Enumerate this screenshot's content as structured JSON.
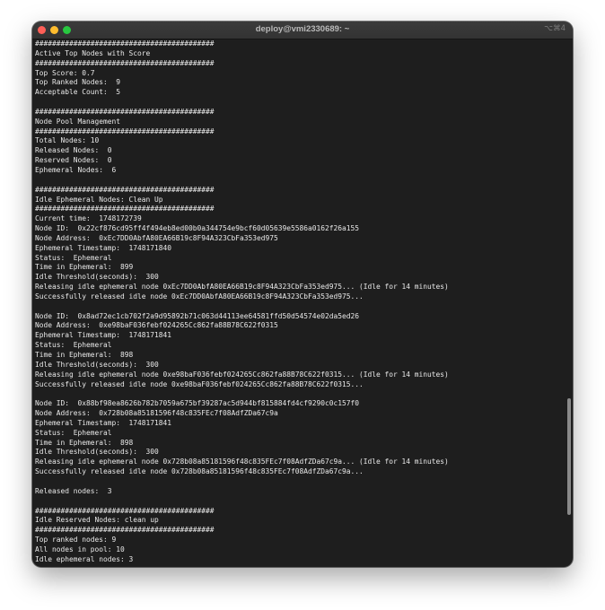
{
  "window": {
    "title": "deploy@vmi2330689: ~",
    "shortcut": "⌥⌘4"
  },
  "terminal": {
    "lines": [
      "##########################################",
      "Active Top Nodes with Score",
      "##########################################",
      "Top Score: 0.7",
      "Top Ranked Nodes:  9",
      "Acceptable Count:  5",
      "",
      "##########################################",
      "Node Pool Management",
      "##########################################",
      "Total Nodes: 10",
      "Released Nodes:  0",
      "Reserved Nodes:  0",
      "Ephemeral Nodes:  6",
      "",
      "##########################################",
      "Idle Ephemeral Nodes: Clean Up",
      "##########################################",
      "Current time:  1748172739",
      "Node ID:  0x22cf876cd95ff4f494eb8ed00b0a344754e9bcf60d05639e5586a0162f26a155",
      "Node Address:  0xEc7DD0AbfA80EA66B19c8F94A323CbFa353ed975",
      "Ephemeral Timestamp:  1748171840",
      "Status:  Ephemeral",
      "Time in Ephemeral:  899",
      "Idle Threshold(seconds):  300",
      "Releasing idle ephemeral node 0xEc7DD0AbfA80EA66B19c8F94A323CbFa353ed975... (Idle for 14 minutes)",
      "Successfully released idle node 0xEc7DD0AbfA80EA66B19c8F94A323CbFa353ed975...",
      "",
      "Node ID:  0x8ad72ec1cb702f2a9d95892b71c063d44113ee64581ffd50d54574e02da5ed26",
      "Node Address:  0xe98baF036febf024265Cc862fa88B78C622f0315",
      "Ephemeral Timestamp:  1748171841",
      "Status:  Ephemeral",
      "Time in Ephemeral:  898",
      "Idle Threshold(seconds):  300",
      "Releasing idle ephemeral node 0xe98baF036febf024265Cc862fa88B78C622f0315... (Idle for 14 minutes)",
      "Successfully released idle node 0xe98baF036febf024265Cc862fa88B78C622f0315...",
      "",
      "Node ID:  0x88bf98ea8626b782b7059a675bf39287ac5d944bf815884fd4cf9290c0c157f0",
      "Node Address:  0x728b08a85181596f48c835FEc7f08AdfZDa67c9a",
      "Ephemeral Timestamp:  1748171841",
      "Status:  Ephemeral",
      "Time in Ephemeral:  898",
      "Idle Threshold(seconds):  300",
      "Releasing idle ephemeral node 0x728b08a85181596f48c835FEc7f08AdfZDa67c9a... (Idle for 14 minutes)",
      "Successfully released idle node 0x728b08a85181596f48c835FEc7f08AdfZDa67c9a...",
      "",
      "Released nodes:  3",
      "",
      "##########################################",
      "Idle Reserved Nodes: clean up",
      "##########################################",
      "Top ranked nodes: 9",
      "All nodes in pool: 10",
      "Idle ephemeral nodes: 3"
    ]
  }
}
